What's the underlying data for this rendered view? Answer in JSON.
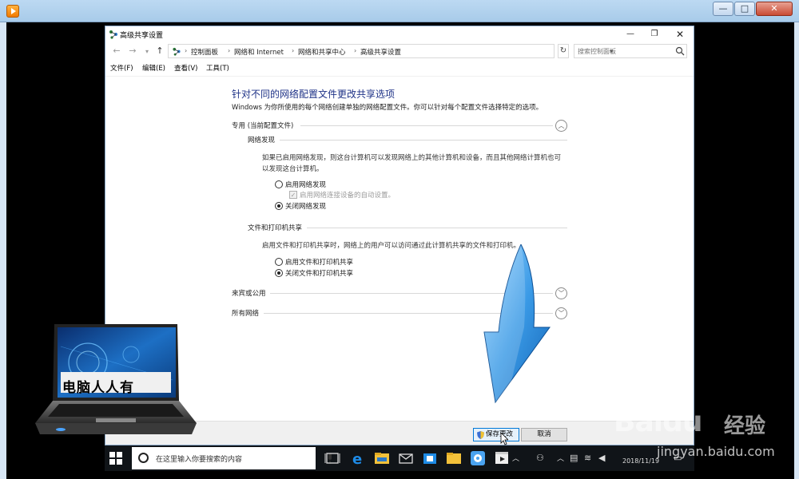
{
  "window": {
    "title": "高级共享设置",
    "minimize": "—",
    "maximize": "❐",
    "close": "✕"
  },
  "address": {
    "crumbs": [
      "控制面板",
      "网络和 Internet",
      "网络和共享中心",
      "高级共享设置"
    ],
    "search_placeholder": "搜索控制面板"
  },
  "menu": [
    "文件(F)",
    "编辑(E)",
    "查看(V)",
    "工具(T)"
  ],
  "page": {
    "title": "针对不同的网络配置文件更改共享选项",
    "description": "Windows 为你所使用的每个网络创建单独的网络配置文件。你可以针对每个配置文件选择特定的选项。"
  },
  "profiles": {
    "private": {
      "label": "专用 (当前配置文件)",
      "expanded": true,
      "discovery": {
        "heading": "网络发现",
        "text": "如果已启用网络发现，则这台计算机可以发现网络上的其他计算机和设备，而且其他网络计算机也可以发现这台计算机。",
        "on_label": "启用网络发现",
        "auto_setup_label": "启用网络连接设备的自动设置。",
        "off_label": "关闭网络发现",
        "selected": "off"
      },
      "file_sharing": {
        "heading": "文件和打印机共享",
        "text": "启用文件和打印机共享时，网络上的用户可以访问通过此计算机共享的文件和打印机。",
        "on_label": "启用文件和打印机共享",
        "off_label": "关闭文件和打印机共享",
        "selected": "off"
      }
    },
    "guest": {
      "label": "来宾或公用",
      "expanded": false
    },
    "all": {
      "label": "所有网络",
      "expanded": false
    }
  },
  "buttons": {
    "save": "保存更改",
    "cancel": "取消"
  },
  "taskbar": {
    "search_placeholder": "在这里输入你要搜索的内容",
    "date": "2018/11/19"
  },
  "overlay": {
    "laptop_caption": "电脑人人有",
    "watermark_logo": "Baidu",
    "watermark_text": "经验",
    "watermark_url": "jingyan.baidu.com"
  },
  "colors": {
    "title_blue": "#1e3287",
    "arrow_blue": "#3a9ae6",
    "taskbar": "#101418"
  }
}
